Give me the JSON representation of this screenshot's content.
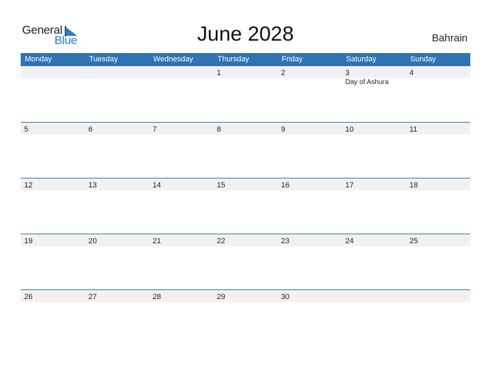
{
  "logo": {
    "general": "General",
    "blue": "Blue"
  },
  "title": "June 2028",
  "country": "Bahrain",
  "colors": {
    "header_bg": "#2f73b5",
    "date_strip": "#f1f1f1",
    "brand_blue": "#2a7bc9"
  },
  "weekdays": [
    "Monday",
    "Tuesday",
    "Wednesday",
    "Thursday",
    "Friday",
    "Saturday",
    "Sunday"
  ],
  "weeks": [
    {
      "days": [
        "",
        "",
        "",
        "1",
        "2",
        "3",
        "4"
      ],
      "events": [
        "",
        "",
        "",
        "",
        "",
        "Day of Ashura",
        ""
      ]
    },
    {
      "days": [
        "5",
        "6",
        "7",
        "8",
        "9",
        "10",
        "11"
      ],
      "events": [
        "",
        "",
        "",
        "",
        "",
        "",
        ""
      ]
    },
    {
      "days": [
        "12",
        "13",
        "14",
        "15",
        "16",
        "17",
        "18"
      ],
      "events": [
        "",
        "",
        "",
        "",
        "",
        "",
        ""
      ]
    },
    {
      "days": [
        "19",
        "20",
        "21",
        "22",
        "23",
        "24",
        "25"
      ],
      "events": [
        "",
        "",
        "",
        "",
        "",
        "",
        ""
      ]
    },
    {
      "days": [
        "26",
        "27",
        "28",
        "29",
        "30",
        "",
        ""
      ],
      "events": [
        "",
        "",
        "",
        "",
        "",
        "",
        ""
      ]
    }
  ]
}
